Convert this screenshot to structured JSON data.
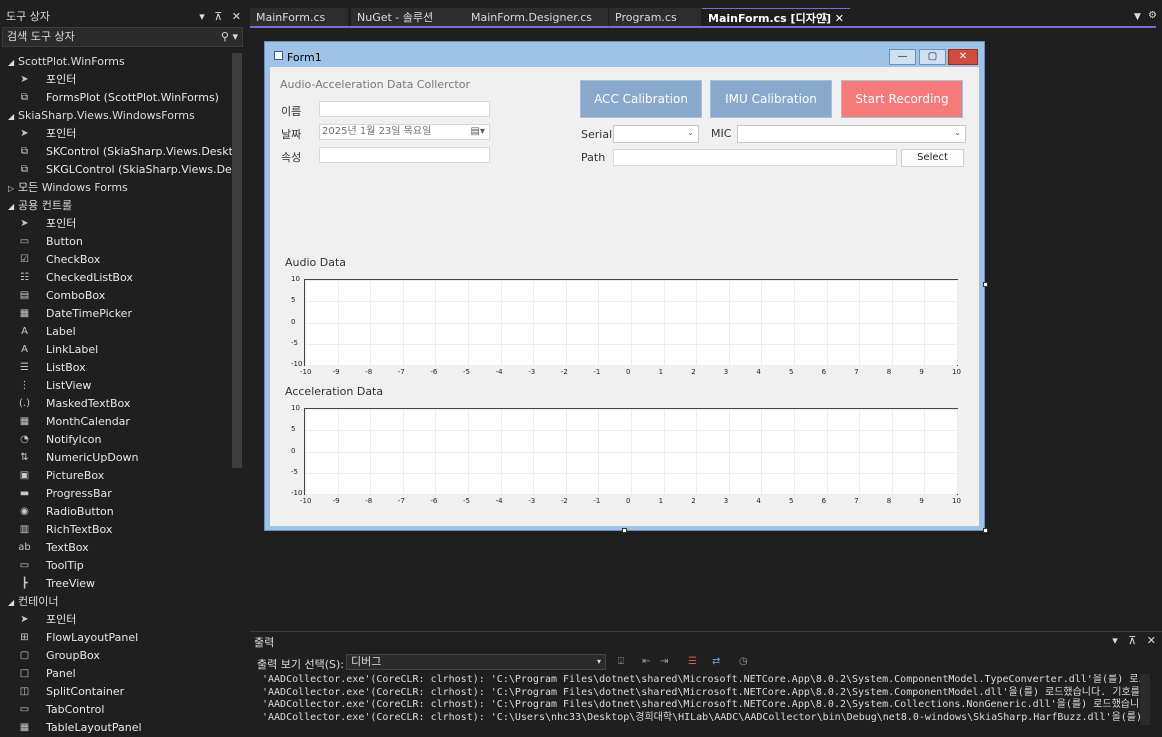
{
  "toolbox": {
    "title": "도구 상자",
    "search_placeholder": "검색 도구 상자",
    "rows": [
      {
        "kind": "cat",
        "label": "ScottPlot.WinForms",
        "expanded": true
      },
      {
        "kind": "item",
        "label": "포인터",
        "icon": "pointer-icon"
      },
      {
        "kind": "item",
        "label": "FormsPlot (ScottPlot.WinForms)",
        "icon": "component-icon"
      },
      {
        "kind": "cat",
        "label": "SkiaSharp.Views.WindowsForms",
        "expanded": true
      },
      {
        "kind": "item",
        "label": "포인터",
        "icon": "pointer-icon"
      },
      {
        "kind": "item",
        "label": "SKControl (SkiaSharp.Views.Desktop)",
        "icon": "component-icon"
      },
      {
        "kind": "item",
        "label": "SKGLControl (SkiaSharp.Views.Deskt...",
        "icon": "component-icon"
      },
      {
        "kind": "cat",
        "label": "모든 Windows Forms",
        "expanded": false
      },
      {
        "kind": "cat",
        "label": "공용 컨트롤",
        "expanded": true
      },
      {
        "kind": "item",
        "label": "포인터",
        "icon": "pointer-icon"
      },
      {
        "kind": "item",
        "label": "Button",
        "icon": "button-icon"
      },
      {
        "kind": "item",
        "label": "CheckBox",
        "icon": "checkbox-icon"
      },
      {
        "kind": "item",
        "label": "CheckedListBox",
        "icon": "checkedlistbox-icon"
      },
      {
        "kind": "item",
        "label": "ComboBox",
        "icon": "combobox-icon"
      },
      {
        "kind": "item",
        "label": "DateTimePicker",
        "icon": "datetimepicker-icon"
      },
      {
        "kind": "item",
        "label": "Label",
        "icon": "label-icon"
      },
      {
        "kind": "item",
        "label": "LinkLabel",
        "icon": "linklabel-icon"
      },
      {
        "kind": "item",
        "label": "ListBox",
        "icon": "listbox-icon"
      },
      {
        "kind": "item",
        "label": "ListView",
        "icon": "listview-icon"
      },
      {
        "kind": "item",
        "label": "MaskedTextBox",
        "icon": "maskedtextbox-icon"
      },
      {
        "kind": "item",
        "label": "MonthCalendar",
        "icon": "monthcalendar-icon"
      },
      {
        "kind": "item",
        "label": "NotifyIcon",
        "icon": "notifyicon-icon"
      },
      {
        "kind": "item",
        "label": "NumericUpDown",
        "icon": "numericupdown-icon"
      },
      {
        "kind": "item",
        "label": "PictureBox",
        "icon": "picturebox-icon"
      },
      {
        "kind": "item",
        "label": "ProgressBar",
        "icon": "progressbar-icon"
      },
      {
        "kind": "item",
        "label": "RadioButton",
        "icon": "radiobutton-icon"
      },
      {
        "kind": "item",
        "label": "RichTextBox",
        "icon": "richtextbox-icon"
      },
      {
        "kind": "item",
        "label": "TextBox",
        "icon": "textbox-icon"
      },
      {
        "kind": "item",
        "label": "ToolTip",
        "icon": "tooltip-icon"
      },
      {
        "kind": "item",
        "label": "TreeView",
        "icon": "treeview-icon"
      },
      {
        "kind": "cat",
        "label": "컨테이너",
        "expanded": true
      },
      {
        "kind": "item",
        "label": "포인터",
        "icon": "pointer-icon"
      },
      {
        "kind": "item",
        "label": "FlowLayoutPanel",
        "icon": "flowlayoutpanel-icon"
      },
      {
        "kind": "item",
        "label": "GroupBox",
        "icon": "groupbox-icon"
      },
      {
        "kind": "item",
        "label": "Panel",
        "icon": "panel-icon"
      },
      {
        "kind": "item",
        "label": "SplitContainer",
        "icon": "splitcontainer-icon"
      },
      {
        "kind": "item",
        "label": "TabControl",
        "icon": "tabcontrol-icon"
      },
      {
        "kind": "item",
        "label": "TableLayoutPanel",
        "icon": "tablelayoutpanel-icon"
      }
    ]
  },
  "tabs": [
    {
      "label": "MainForm.cs",
      "active": false
    },
    {
      "label": "NuGet - 솔루션",
      "active": false
    },
    {
      "label": "MainForm.Designer.cs",
      "active": false
    },
    {
      "label": "Program.cs",
      "active": false
    },
    {
      "label": "MainForm.cs [디자인]",
      "active": true
    }
  ],
  "form": {
    "title": "Form1",
    "heading": "Audio-Acceleration Data Collerctor",
    "name_label": "이름",
    "date_label": "날짜",
    "date_value": "2025년   1월 23일 목요일",
    "attr_label": "속성",
    "acc_button": "ACC Calibration",
    "imu_button": "IMU Calibration",
    "record_button": "Start Recording",
    "serial_label": "Serial",
    "mic_label": "MIC",
    "path_label": "Path",
    "select_button": "Select",
    "audio_title": "Audio Data",
    "accel_title": "Acceleration Data",
    "colors": {
      "calib": "#88a9cc",
      "record": "#f57b7b"
    }
  },
  "chart_data": [
    {
      "type": "line",
      "title": "Audio Data",
      "x_ticks": [
        "-10",
        "-9",
        "-8",
        "-7",
        "-6",
        "-5",
        "-4",
        "-3",
        "-2",
        "-1",
        "0",
        "1",
        "2",
        "3",
        "4",
        "5",
        "6",
        "7",
        "8",
        "9",
        "10"
      ],
      "y_ticks": [
        "10",
        "5",
        "0",
        "-5",
        "-10"
      ],
      "xlim": [
        -10,
        10
      ],
      "ylim": [
        -10,
        10
      ],
      "series": [],
      "grid": true
    },
    {
      "type": "line",
      "title": "Acceleration Data",
      "x_ticks": [
        "-10",
        "-9",
        "-8",
        "-7",
        "-6",
        "-5",
        "-4",
        "-3",
        "-2",
        "-1",
        "0",
        "1",
        "2",
        "3",
        "4",
        "5",
        "6",
        "7",
        "8",
        "9",
        "10"
      ],
      "y_ticks": [
        "10",
        "5",
        "0",
        "-5",
        "-10"
      ],
      "xlim": [
        -10,
        10
      ],
      "ylim": [
        -10,
        10
      ],
      "series": [],
      "grid": true
    }
  ],
  "output": {
    "title": "출력",
    "source_label": "출력 보기 선택(S):",
    "source_value": "디버그",
    "lines": [
      "'AADCollector.exe'(CoreCLR: clrhost): 'C:\\Program Files\\dotnet\\shared\\Microsoft.NETCore.App\\8.0.2\\System.ComponentModel.TypeConverter.dll'을(를) 로드했습니다. 기호를 로드하지 않고 건너뛰었습니다.",
      "'AADCollector.exe'(CoreCLR: clrhost): 'C:\\Program Files\\dotnet\\shared\\Microsoft.NETCore.App\\8.0.2\\System.ComponentModel.dll'을(를) 로드했습니다. 기호를 로드하지 않고 건너뛰었습니다.",
      "'AADCollector.exe'(CoreCLR: clrhost): 'C:\\Program Files\\dotnet\\shared\\Microsoft.NETCore.App\\8.0.2\\System.Collections.NonGeneric.dll'을(를) 로드했습니다. 기호를 로드하지 않고 건너뛰었습니다.",
      "'AADCollector.exe'(CoreCLR: clrhost): 'C:\\Users\\nhc33\\Desktop\\경희대학\\HILab\\AADC\\AADCollector\\bin\\Debug\\net8.0-windows\\SkiaSharp.HarfBuzz.dll'을(를) 로드했습니다. 기호를 로드"
    ]
  }
}
